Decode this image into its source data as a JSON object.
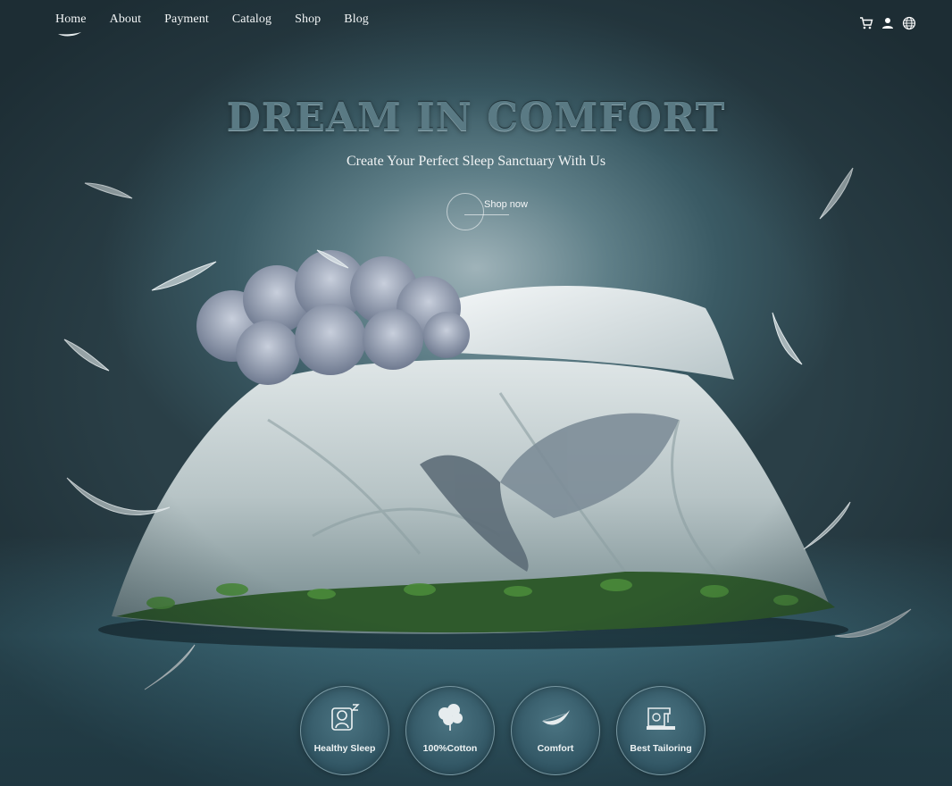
{
  "nav": {
    "items": [
      {
        "label": "Home",
        "active": true
      },
      {
        "label": "About"
      },
      {
        "label": "Payment"
      },
      {
        "label": "Catalog"
      },
      {
        "label": "Shop"
      },
      {
        "label": "Blog"
      }
    ],
    "icons": [
      "cart-icon",
      "user-icon",
      "globe-icon"
    ]
  },
  "hero": {
    "title": "DREAM IN COMFORT",
    "subtitle": "Create Your Perfect Sleep Sanctuary With Us",
    "cta_label": "Shop now"
  },
  "features": [
    {
      "label": "Healthy Sleep",
      "icon": "healthy-sleep-icon"
    },
    {
      "label": "100%Cotton",
      "icon": "cotton-icon"
    },
    {
      "label": "Comfort",
      "icon": "feather-icon"
    },
    {
      "label": "Best Tailoring",
      "icon": "sewing-machine-icon"
    }
  ],
  "colors": {
    "background": "#3a5a64",
    "title": "#5a7a84",
    "text": "#f0f3f4"
  }
}
